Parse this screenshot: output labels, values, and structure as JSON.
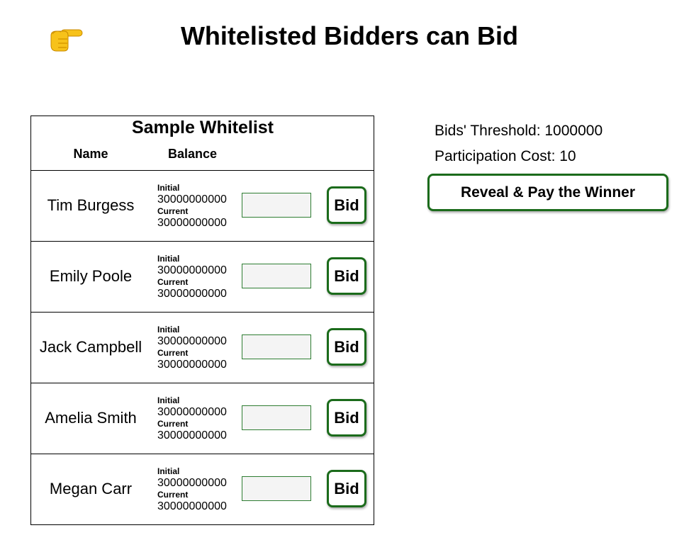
{
  "header": {
    "icon": "pointing-hand-icon",
    "title": "Whitelisted Bidders can Bid"
  },
  "whitelist": {
    "title": "Sample Whitelist",
    "columns": {
      "name": "Name",
      "balance": "Balance"
    },
    "rows": [
      {
        "name": "Tim Burgess",
        "initial_label": "Initial",
        "initial": "30000000000",
        "current_label": "Current",
        "current": "30000000000",
        "bid_value": "",
        "bid_label": "Bid"
      },
      {
        "name": "Emily Poole",
        "initial_label": "Initial",
        "initial": "30000000000",
        "current_label": "Current",
        "current": "30000000000",
        "bid_value": "",
        "bid_label": "Bid"
      },
      {
        "name": "Jack Campbell",
        "initial_label": "Initial",
        "initial": "30000000000",
        "current_label": "Current",
        "current": "30000000000",
        "bid_value": "",
        "bid_label": "Bid"
      },
      {
        "name": "Amelia Smith",
        "initial_label": "Initial",
        "initial": "30000000000",
        "current_label": "Current",
        "current": "30000000000",
        "bid_value": "",
        "bid_label": "Bid"
      },
      {
        "name": "Megan Carr",
        "initial_label": "Initial",
        "initial": "30000000000",
        "current_label": "Current",
        "current": "30000000000",
        "bid_value": "",
        "bid_label": "Bid"
      }
    ]
  },
  "auction": {
    "threshold_text": "Bids' Threshold: 1000000",
    "participation_text": "Participation Cost: 10",
    "reveal_label": "Reveal & Pay the Winner"
  },
  "colors": {
    "accent_green": "#1b6b1b",
    "input_border": "#2e7d32",
    "input_bg": "#f4f4f4",
    "hand_yellow": "#f5b800"
  }
}
